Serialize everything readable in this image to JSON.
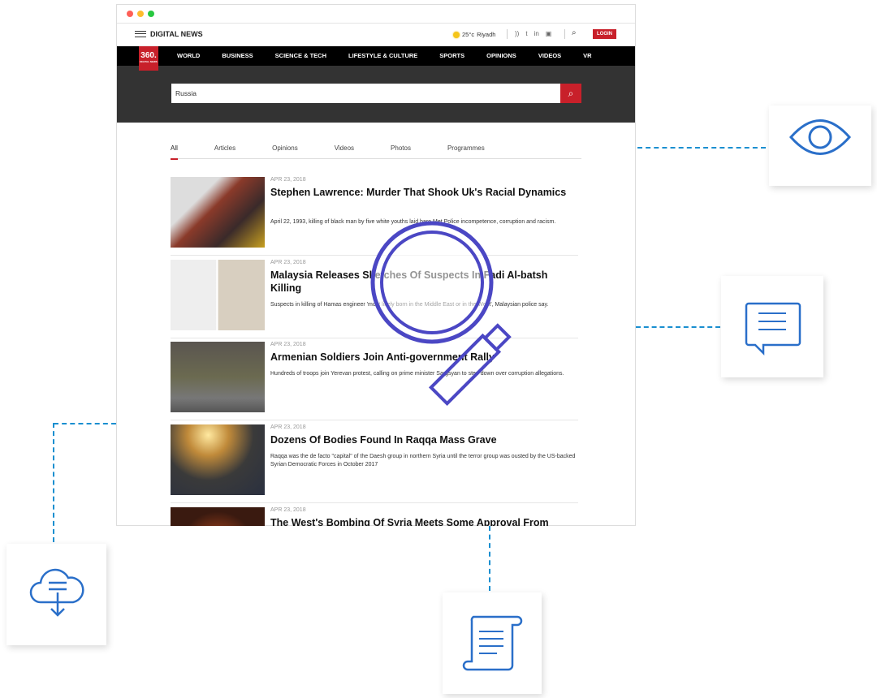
{
  "header": {
    "brand": "DIGITAL NEWS",
    "temperature": "25°c",
    "city": "Riyadh",
    "login": "LOGIN",
    "logo": "360.",
    "logo_sub": "DIGITAL NEWS"
  },
  "nav": [
    "WORLD",
    "BUSINESS",
    "SCIENCE & TECH",
    "LIFESTYLE & CULTURE",
    "SPORTS",
    "OPINIONS",
    "VIDEOS",
    "VR"
  ],
  "search": {
    "value": "Russia"
  },
  "tabs": [
    "All",
    "Articles",
    "Opinions",
    "Videos",
    "Photos",
    "Programmes"
  ],
  "articles": [
    {
      "date": "APR 23, 2018",
      "title": "Stephen Lawrence: Murder That Shook Uk's Racial Dynamics",
      "desc": "April 22, 1993, killing of black man by five white youths laid bare Met Police incompetence, corruption and racism."
    },
    {
      "date": "APR 23, 2018",
      "title": "Malaysia Releases Sketches Of Suspects In Fadi Al-batsh Killing",
      "desc": "Suspects in killing of Hamas engineer 'most likely born in the Middle East or in the West', Malaysian police say."
    },
    {
      "date": "APR 23, 2018",
      "title": "Armenian Soldiers Join Anti-government Rally",
      "desc": "Hundreds of troops join Yerevan protest, calling on prime minister Sargsyan to step down over corruption allegations."
    },
    {
      "date": "APR 23, 2018",
      "title": "Dozens Of Bodies Found In Raqqa Mass Grave",
      "desc": "Raqqa was the de facto \"capital\" of the Daesh group in northern Syria until the terror group was ousted by the US-backed Syrian Democratic Forces in October 2017"
    },
    {
      "date": "APR 23, 2018",
      "title": "The West's Bombing Of Syria Meets Some Approval From",
      "desc": ""
    }
  ],
  "colors": {
    "accent": "#c8202a",
    "icon": "#2a6fc9",
    "dash": "#1a8fd0",
    "magnifier": "#4b47c4"
  }
}
